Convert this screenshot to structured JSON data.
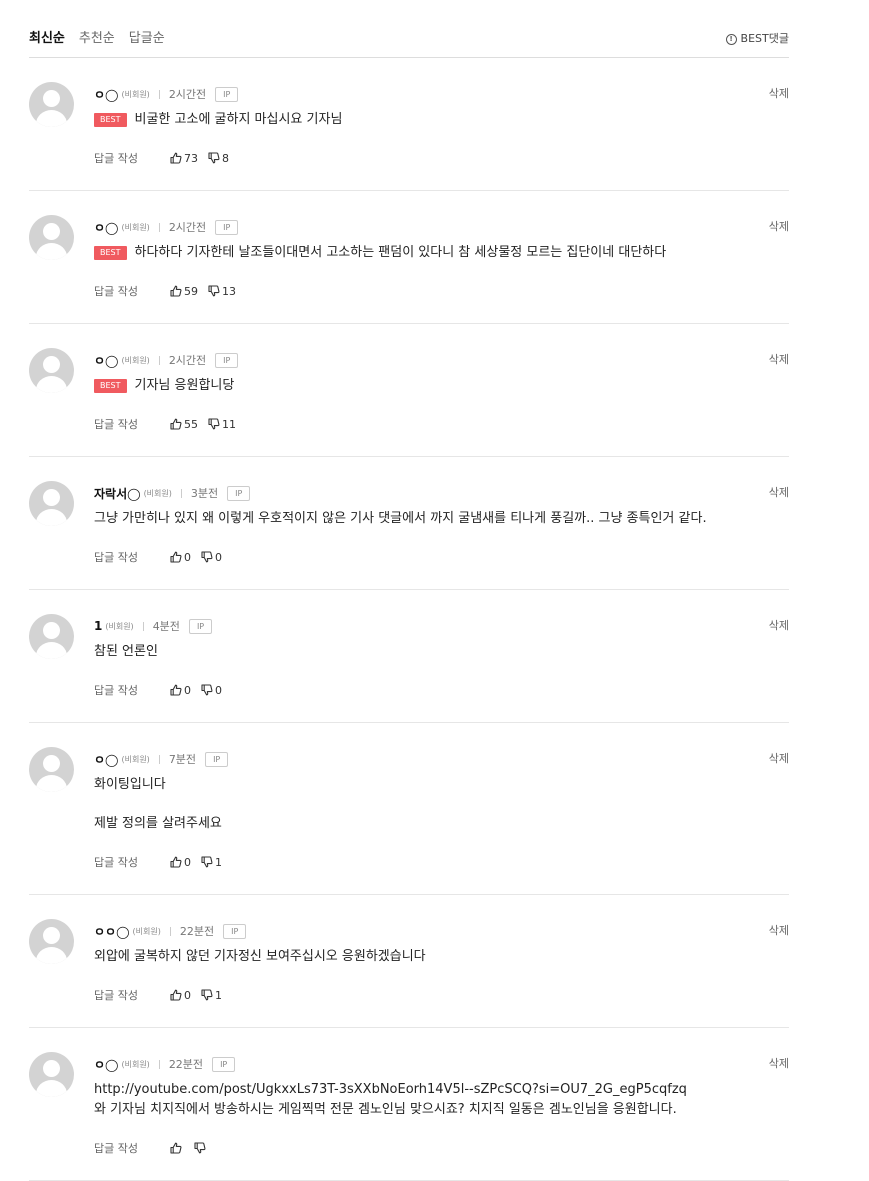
{
  "sort": {
    "tabs": [
      "최신순",
      "추천순",
      "답글순"
    ],
    "active": 0,
    "best_label": "BEST댓글"
  },
  "labels": {
    "member": "(비회원)",
    "ip": "IP",
    "delete": "삭제",
    "reply": "답글 작성",
    "best": "BEST"
  },
  "comments": [
    {
      "nick": "ㅇ◯",
      "time": "2시간전",
      "ip": true,
      "best": true,
      "text": [
        "비굴한 고소에 굴하지 마십시요 기자님"
      ],
      "likes": "73",
      "dislikes": "8"
    },
    {
      "nick": "ㅇ◯",
      "time": "2시간전",
      "ip": true,
      "best": true,
      "text": [
        "하다하다 기자한테 날조들이대면서 고소하는 팬덤이 있다니 참 세상물정 모르는 집단이네 대단하다"
      ],
      "likes": "59",
      "dislikes": "13"
    },
    {
      "nick": "ㅇ◯",
      "time": "2시간전",
      "ip": true,
      "best": true,
      "text": [
        "기자님 응원합니당"
      ],
      "likes": "55",
      "dislikes": "11"
    },
    {
      "nick": "자락서◯",
      "time": "3분전",
      "ip": true,
      "best": false,
      "text": [
        "그냥 가만히나 있지 왜 이렇게 우호적이지 않은 기사 댓글에서 까지 굴냄새를 티나게 풍길까.. 그냥 종특인거 같다."
      ],
      "likes": "0",
      "dislikes": "0"
    },
    {
      "nick": "1",
      "time": "4분전",
      "ip": true,
      "best": false,
      "text": [
        "참된 언론인"
      ],
      "likes": "0",
      "dislikes": "0"
    },
    {
      "nick": "ㅇ◯",
      "time": "7분전",
      "ip": true,
      "best": false,
      "text": [
        "화이팅입니다",
        "제발 정의를 살려주세요"
      ],
      "likes": "0",
      "dislikes": "1"
    },
    {
      "nick": "ㅇㅇ◯",
      "time": "22분전",
      "ip": true,
      "best": false,
      "text": [
        "외압에 굴복하지 않던 기자정신 보여주십시오 응원하겠습니다"
      ],
      "likes": "0",
      "dislikes": "1"
    },
    {
      "nick": "ㅇ◯",
      "time": "22분전",
      "ip": true,
      "best": false,
      "tight": true,
      "text": [
        "http://youtube.com/post/UgkxxLs73T-3sXXbNoEorh14V5l--sZPcSCQ?si=OU7_2G_egP5cqfzq",
        "와 기자님 치지직에서 방송하시는 게임찍먹 전문 겜노인님 맞으시죠? 치지직 일동은 겜노인님을 응원합니다."
      ],
      "likes": "",
      "dislikes": ""
    }
  ]
}
